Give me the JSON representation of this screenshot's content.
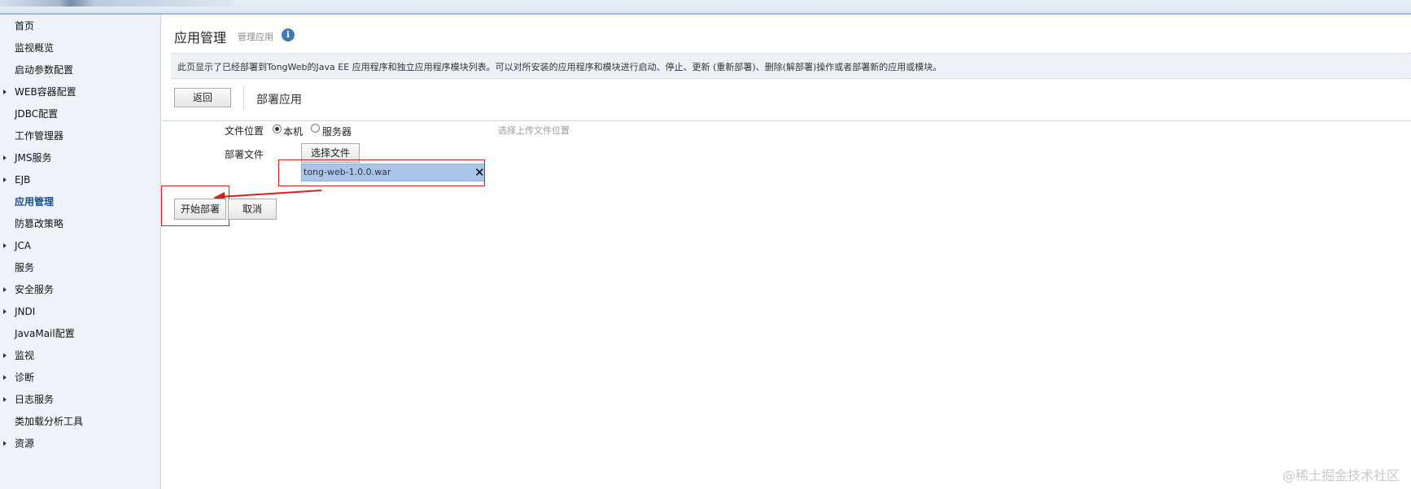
{
  "sidebar": {
    "items": [
      {
        "label": "首页",
        "expandable": false
      },
      {
        "label": "监视概览",
        "expandable": false
      },
      {
        "label": "启动参数配置",
        "expandable": false
      },
      {
        "label": "WEB容器配置",
        "expandable": true
      },
      {
        "label": "JDBC配置",
        "expandable": false
      },
      {
        "label": "工作管理器",
        "expandable": false
      },
      {
        "label": "JMS服务",
        "expandable": true
      },
      {
        "label": "EJB",
        "expandable": true
      },
      {
        "label": "应用管理",
        "expandable": false,
        "active": true
      },
      {
        "label": "防篡改策略",
        "expandable": false
      },
      {
        "label": "JCA",
        "expandable": true
      },
      {
        "label": "服务",
        "expandable": false
      },
      {
        "label": "安全服务",
        "expandable": true
      },
      {
        "label": "JNDI",
        "expandable": true
      },
      {
        "label": "JavaMail配置",
        "expandable": false
      },
      {
        "label": "监视",
        "expandable": true
      },
      {
        "label": "诊断",
        "expandable": true
      },
      {
        "label": "日志服务",
        "expandable": true
      },
      {
        "label": "类加载分析工具",
        "expandable": false
      },
      {
        "label": "资源",
        "expandable": true
      }
    ]
  },
  "header": {
    "title": "应用管理",
    "subtitle": "管理应用",
    "info_icon": "i"
  },
  "description": "此页显示了已经部署到TongWeb的Java EE 应用程序和独立应用程序模块列表。可以对所安装的应用程序和模块进行启动、停止、更新 (重新部署)、删除(解部署)操作或者部署新的应用或模块。",
  "toolbar": {
    "back_label": "返回",
    "section_title": "部署应用"
  },
  "form": {
    "file_location_label": "文件位置",
    "options": [
      {
        "label": "本机",
        "checked": true
      },
      {
        "label": "服务器",
        "checked": false
      }
    ],
    "hint": "选择上传文件位置",
    "deploy_file_label": "部署文件",
    "choose_file_label": "选择文件",
    "selected_file": "tong-web-1.0.0.war",
    "remove_symbol": "✕"
  },
  "actions": {
    "start_label": "开始部署",
    "cancel_label": "取消"
  },
  "watermark": "@稀土掘金技术社区",
  "colors": {
    "annotation": "#d62020",
    "file_highlight": "#a9c6ea",
    "sidebar_bg": "#eef3fa",
    "active_nav": "#1b4e8c"
  }
}
